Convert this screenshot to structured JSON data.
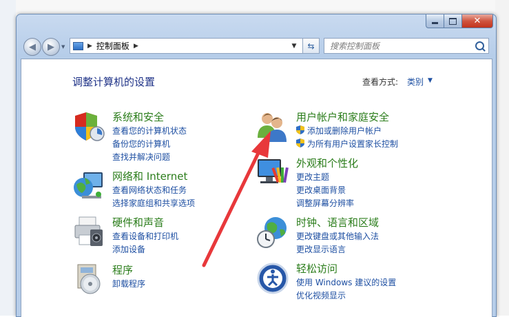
{
  "window": {
    "caption": {
      "close": "✕"
    },
    "address": {
      "crumbs": [
        "控制面板"
      ]
    },
    "search": {
      "placeholder": "搜索控制面板"
    }
  },
  "header": {
    "title": "调整计算机的设置",
    "view_by_label": "查看方式:",
    "view_by_value": "类别"
  },
  "categories": [
    {
      "icon": "security-shield-icon",
      "title": "系统和安全",
      "links": [
        "查看您的计算机状态",
        "备份您的计算机",
        "查找并解决问题"
      ]
    },
    {
      "icon": "network-globe-icon",
      "title": "网络和 Internet",
      "links": [
        "查看网络状态和任务",
        "选择家庭组和共享选项"
      ]
    },
    {
      "icon": "printer-icon",
      "title": "硬件和声音",
      "links": [
        "查看设备和打印机",
        "添加设备"
      ]
    },
    {
      "icon": "programs-disc-icon",
      "title": "程序",
      "links": [
        "卸载程序"
      ]
    },
    {
      "icon": "users-icon",
      "title": "用户帐户和家庭安全",
      "links": [
        "添加或删除用户帐户",
        "为所有用户设置家长控制"
      ]
    },
    {
      "icon": "appearance-monitor-icon",
      "title": "外观和个性化",
      "links": [
        "更改主题",
        "更改桌面背景",
        "调整屏幕分辨率"
      ]
    },
    {
      "icon": "clock-globe-icon",
      "title": "时钟、语言和区域",
      "links": [
        "更改键盘或其他输入法",
        "更改显示语言"
      ]
    },
    {
      "icon": "ease-of-access-icon",
      "title": "轻松访问",
      "links": [
        "使用 Windows 建议的设置",
        "优化视频显示"
      ]
    }
  ],
  "colors": {
    "title_green": "#2b7d1b",
    "link_blue": "#1e4fa2",
    "heading_blue": "#1e3287",
    "annotation_red": "#e8383b"
  }
}
